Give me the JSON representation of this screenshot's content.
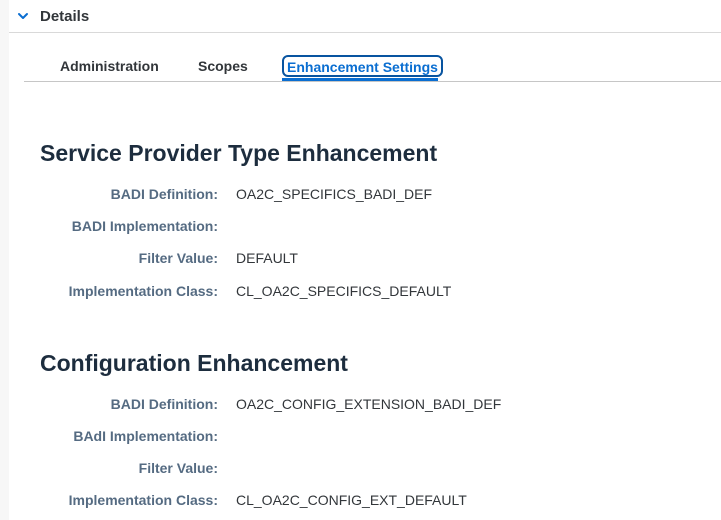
{
  "panel": {
    "title": "Details"
  },
  "tabs": [
    {
      "label": "Administration"
    },
    {
      "label": "Scopes"
    },
    {
      "label": "Enhancement Settings",
      "selected": true
    }
  ],
  "sections": [
    {
      "title": "Service Provider Type Enhancement",
      "fields": [
        {
          "label": "BADI Definition:",
          "value": "OA2C_SPECIFICS_BADI_DEF"
        },
        {
          "label": "BADI Implementation:",
          "value": ""
        },
        {
          "label": "Filter Value:",
          "value": "DEFAULT"
        },
        {
          "label": "Implementation Class:",
          "value": "CL_OA2C_SPECIFICS_DEFAULT"
        }
      ]
    },
    {
      "title": "Configuration Enhancement",
      "fields": [
        {
          "label": "BADI Definition:",
          "value": "OA2C_CONFIG_EXTENSION_BADI_DEF"
        },
        {
          "label": "BAdI Implementation:",
          "value": ""
        },
        {
          "label": "Filter Value:",
          "value": ""
        },
        {
          "label": "Implementation Class:",
          "value": "CL_OA2C_CONFIG_EXT_DEFAULT"
        }
      ]
    }
  ],
  "colors": {
    "accent": "#0a6ed1",
    "label": "#556b82",
    "heading": "#1d2d3e"
  },
  "icons": {
    "collapse": "chevron-down-icon"
  }
}
